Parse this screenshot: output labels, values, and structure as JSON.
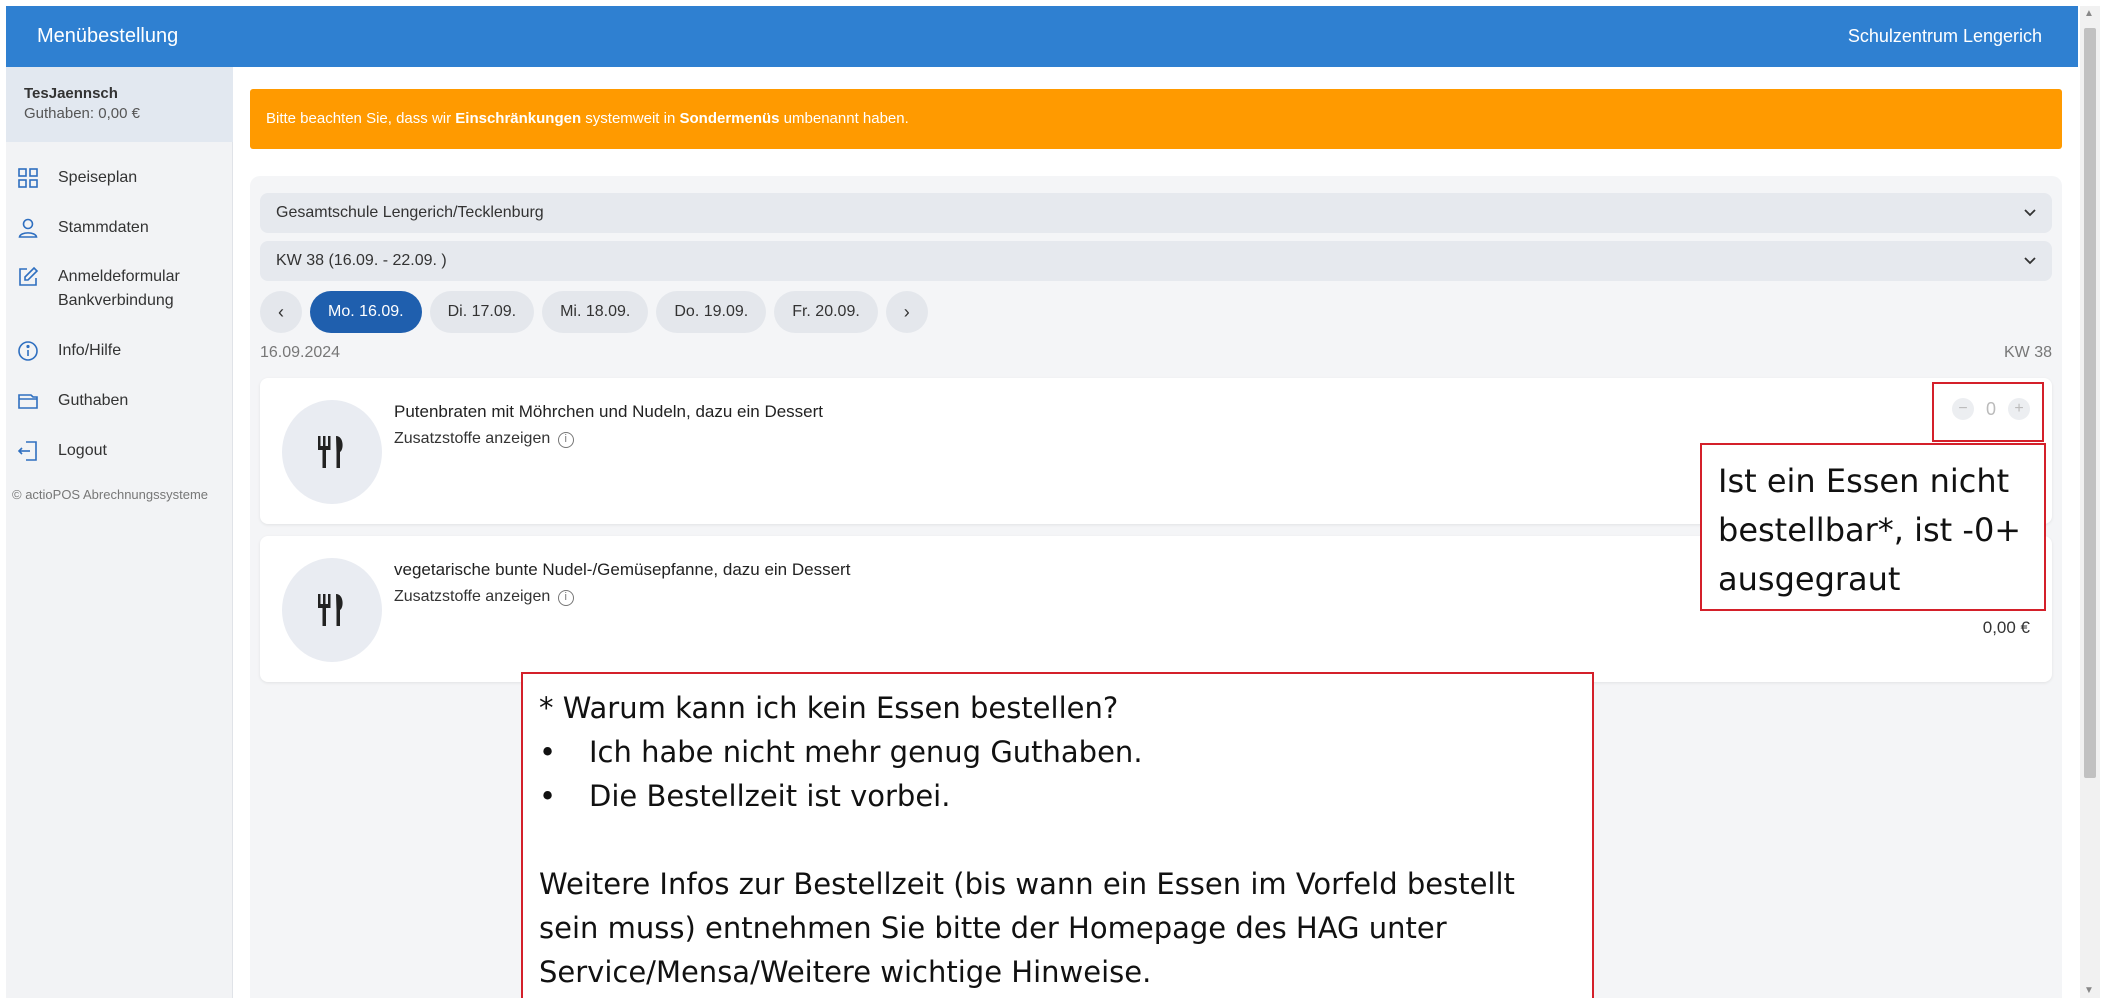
{
  "header": {
    "app_title": "Menübestellung",
    "school": "Schulzentrum Lengerich"
  },
  "user": {
    "name": "TesJaennsch",
    "credit": "Guthaben: 0,00 €"
  },
  "sidebar": {
    "items": [
      {
        "label": "Speiseplan",
        "icon": "grid-icon"
      },
      {
        "label": "Stammdaten",
        "icon": "user-icon"
      },
      {
        "label": "Anmeldeformular",
        "label2": "Bankverbindung",
        "icon": "edit-icon"
      },
      {
        "label": "Info/Hilfe",
        "icon": "info-icon"
      },
      {
        "label": "Guthaben",
        "icon": "wallet-icon"
      },
      {
        "label": "Logout",
        "icon": "logout-icon"
      }
    ],
    "footer": "© actioPOS Abrechnungssysteme"
  },
  "notice": {
    "prefix": "Bitte beachten Sie, dass wir ",
    "bold1": "Einschränkungen",
    "middle": " systemweit in ",
    "bold2": "Sondermenüs",
    "suffix": " umbenannt haben.",
    "color": "#ff9a00"
  },
  "filters": {
    "school_select": "Gesamtschule Lengerich/Tecklenburg",
    "week_select": "KW 38 (16.09. - 22.09. )"
  },
  "days": {
    "prev": "‹",
    "next": "›",
    "items": [
      "Mo. 16.09.",
      "Di. 17.09.",
      "Mi. 18.09.",
      "Do. 19.09.",
      "Fr. 20.09."
    ],
    "active_index": 0
  },
  "day_info": {
    "date": "16.09.2024",
    "week": "KW 38"
  },
  "meals": [
    {
      "name": "Putenbraten mit Möhrchen und Nudeln, dazu ein Dessert",
      "additives": "Zusatzstoffe anzeigen",
      "minus": "−",
      "qty": "0",
      "plus": "+"
    },
    {
      "name": "vegetarische bunte Nudel-/Gemüsepfanne, dazu ein Dessert",
      "additives": "Zusatzstoffe anzeigen",
      "price": "0,00 €"
    }
  ],
  "annotations": {
    "right_line1": "Ist ein Essen nicht",
    "right_line2": "bestellbar*, ist -0+",
    "right_line3": "ausgegraut",
    "bottom_title": "* Warum kann ich kein Essen bestellen?",
    "bullet_char": "•",
    "bullet1": "Ich habe nicht mehr genug Guthaben.",
    "bullet2": "Die Bestellzeit ist vorbei.",
    "info_line1": "Weitere Infos zur Bestellzeit (bis wann ein Essen im Vorfeld bestellt",
    "info_line2": "sein muss) entnehmen Sie bitte der Homepage des HAG unter",
    "info_line3": "Service/Mensa/Weitere wichtige Hinweise.",
    "border_color": "#d4202a"
  },
  "colors": {
    "primary": "#2f80d1",
    "active_day": "#1f5fae"
  }
}
